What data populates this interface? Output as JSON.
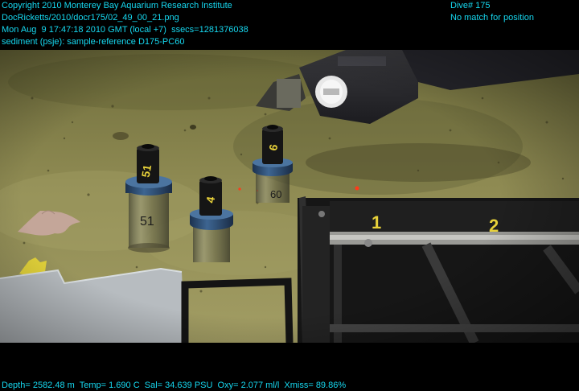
{
  "header_left": {
    "copyright": "Copyright 2010 Monterey Bay Aquarium Research Institute",
    "file": "DocRicketts/2010/docr175/02_49_00_21.png",
    "timestamp": "Mon Aug  9 17:47:18 2010 GMT (local +7)  ssecs=1281376038",
    "sample": "sediment (psje): sample-reference D175-PC60"
  },
  "header_right": {
    "dive": "Dive# 175",
    "position_status": "No match for position"
  },
  "footer": {
    "telemetry": "Depth= 2582.48 m  Temp= 1.690 C  Sal= 34.639 PSU  Oxy= 2.077 ml/l  Xmiss= 89.86%"
  },
  "scene": {
    "core_labels": [
      "51",
      "4",
      "6",
      "60"
    ],
    "crate_labels": [
      "1",
      "2"
    ],
    "colors": {
      "overlay_text": "#16d8f0",
      "sediment": "#8e8a52",
      "core_cap": "#2e4f78",
      "label_yellow": "#e8d23a"
    }
  }
}
